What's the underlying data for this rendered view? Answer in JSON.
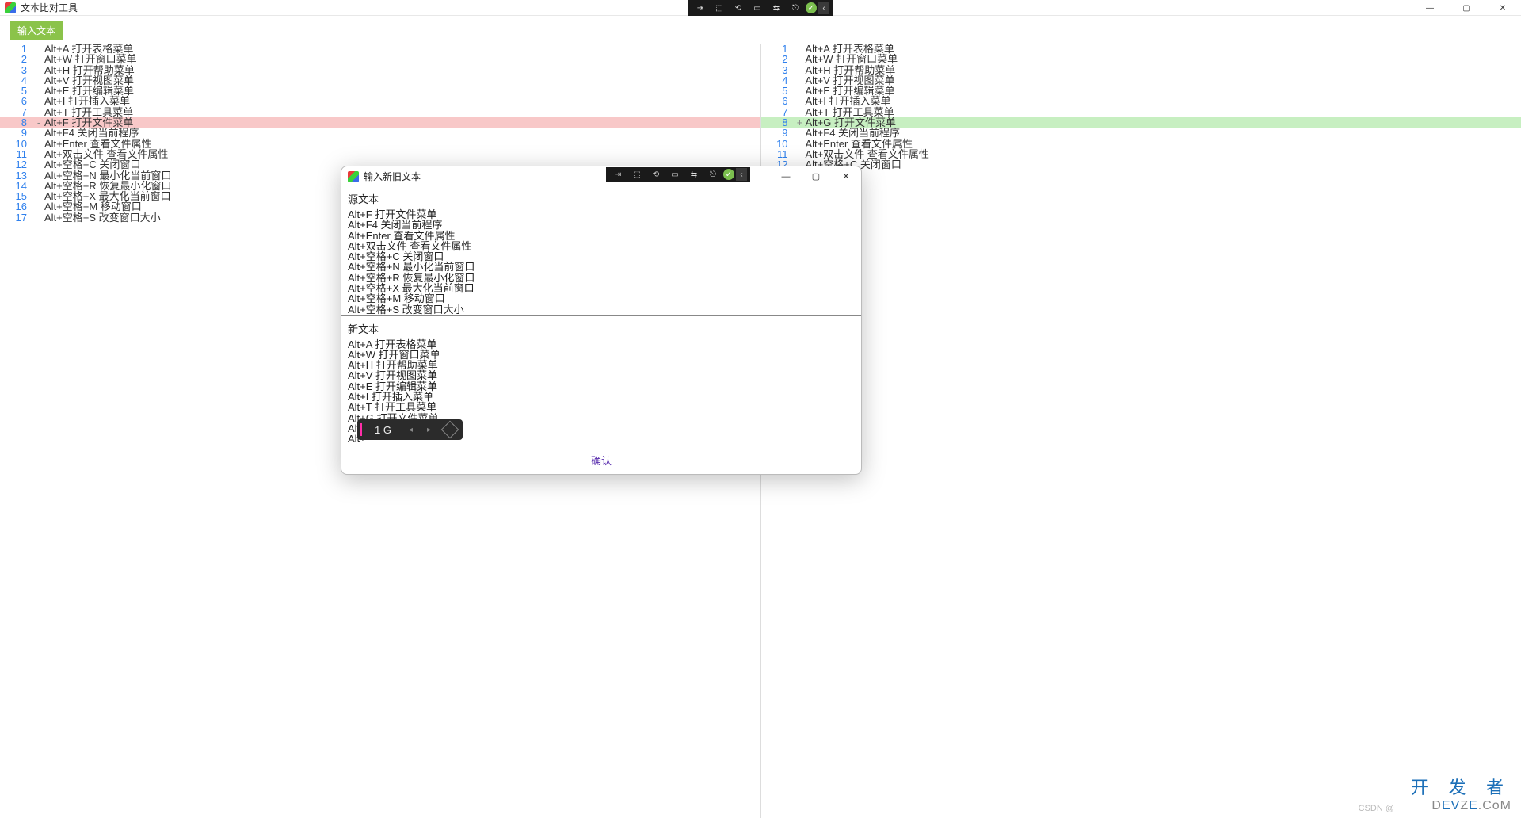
{
  "app": {
    "title": "文本比对工具",
    "input_button": "输入文本"
  },
  "win_controls": {
    "min": "—",
    "max": "▢",
    "close": "✕"
  },
  "black_toolbar_icons": [
    "⇥",
    "⬚",
    "⟲",
    "▭",
    "⇆",
    "⎋",
    "ok",
    "‹"
  ],
  "left_lines": [
    {
      "n": 1,
      "t": "Alt+A 打开表格菜单"
    },
    {
      "n": 2,
      "t": "Alt+W 打开窗口菜单"
    },
    {
      "n": 3,
      "t": "Alt+H 打开帮助菜单"
    },
    {
      "n": 4,
      "t": "Alt+V 打开视图菜单"
    },
    {
      "n": 5,
      "t": "Alt+E 打开编辑菜单"
    },
    {
      "n": 6,
      "t": "Alt+I 打开插入菜单"
    },
    {
      "n": 7,
      "t": "Alt+T 打开工具菜单"
    },
    {
      "n": 8,
      "t": "Alt+F 打开文件菜单",
      "cls": "removed",
      "mark": "-"
    },
    {
      "n": 9,
      "t": "Alt+F4 关闭当前程序"
    },
    {
      "n": 10,
      "t": "Alt+Enter 查看文件属性"
    },
    {
      "n": 11,
      "t": "Alt+双击文件 查看文件属性"
    },
    {
      "n": 12,
      "t": "Alt+空格+C 关闭窗口"
    },
    {
      "n": 13,
      "t": "Alt+空格+N 最小化当前窗口"
    },
    {
      "n": 14,
      "t": "Alt+空格+R 恢复最小化窗口"
    },
    {
      "n": 15,
      "t": "Alt+空格+X 最大化当前窗口"
    },
    {
      "n": 16,
      "t": "Alt+空格+M 移动窗口"
    },
    {
      "n": 17,
      "t": "Alt+空格+S 改变窗口大小"
    }
  ],
  "right_lines": [
    {
      "n": 1,
      "t": "Alt+A 打开表格菜单"
    },
    {
      "n": 2,
      "t": "Alt+W 打开窗口菜单"
    },
    {
      "n": 3,
      "t": "Alt+H 打开帮助菜单"
    },
    {
      "n": 4,
      "t": "Alt+V 打开视图菜单"
    },
    {
      "n": 5,
      "t": "Alt+E 打开编辑菜单"
    },
    {
      "n": 6,
      "t": "Alt+I 打开插入菜单"
    },
    {
      "n": 7,
      "t": "Alt+T 打开工具菜单"
    },
    {
      "n": 8,
      "t": "Alt+G 打开文件菜单",
      "cls": "added",
      "mark": "+"
    },
    {
      "n": 9,
      "t": "Alt+F4 关闭当前程序"
    },
    {
      "n": 10,
      "t": "Alt+Enter 查看文件属性"
    },
    {
      "n": 11,
      "t": "Alt+双击文件 查看文件属性"
    },
    {
      "n": 12,
      "t": "Alt+空格+C 关闭窗口"
    }
  ],
  "modal": {
    "title": "输入新旧文本",
    "src_label": "源文本",
    "new_label": "新文本",
    "confirm": "确认",
    "src_lines": [
      "Alt+F 打开文件菜单",
      "Alt+F4 关闭当前程序",
      "Alt+Enter 查看文件属性",
      "Alt+双击文件 查看文件属性",
      "Alt+空格+C 关闭窗口",
      "Alt+空格+N 最小化当前窗口",
      "Alt+空格+R 恢复最小化窗口",
      "Alt+空格+X 最大化当前窗口",
      "Alt+空格+M 移动窗口",
      "Alt+空格+S 改变窗口大小"
    ],
    "new_lines": [
      "Alt+A 打开表格菜单",
      "Alt+W 打开窗口菜单",
      "Alt+H 打开帮助菜单",
      "Alt+V 打开视图菜单",
      "Alt+E 打开编辑菜单",
      "Alt+I 打开插入菜单",
      "Alt+T 打开工具菜单",
      "Alt+G 打开文件菜单",
      "Alt+",
      "Alt+"
    ]
  },
  "ime": {
    "candidate": "1 G"
  },
  "watermark": {
    "line1": "开 发 者",
    "line2_pre": "D",
    "line2_hl": "EV",
    "line2_mid": "Z",
    "line2_mid2": "E",
    "line2_post": ".CoM",
    "csdn": "CSDN @"
  }
}
